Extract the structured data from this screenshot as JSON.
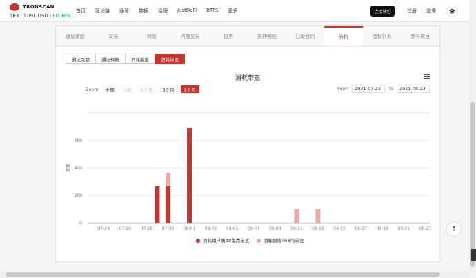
{
  "header": {
    "logo_text": "TRONSCAN",
    "price_label": "TRX: 0.091 USD",
    "price_change": "(+0.98%)",
    "nav": [
      "首页",
      "区块链",
      "通证",
      "数据",
      "治理",
      "JustDeFi",
      "BTFS",
      "更多"
    ],
    "connect_label": "连接钱包",
    "register_label": "注册",
    "login_label": "登录"
  },
  "tabs": [
    "通证余额",
    "交易",
    "转账",
    "内部交易",
    "投票",
    "质押明细",
    "已发合约",
    "分析",
    "授权列表",
    "参与项目"
  ],
  "active_tab": 7,
  "subtabs": [
    "通证余额",
    "通证转账",
    "消耗能量",
    "消耗带宽"
  ],
  "active_subtab": 3,
  "chart_controls": {
    "zoom_label": "Zoom",
    "zoom_options": [
      "全部",
      "1年",
      "6个月",
      "3个月",
      "1个月"
    ],
    "zoom_active": 4,
    "zoom_disabled": [
      1,
      2
    ],
    "from_label": "From",
    "from_value": "2021-07-23",
    "to_label": "To",
    "to_value": "2021-08-23"
  },
  "chart_data": {
    "type": "bar",
    "title": "消耗带宽",
    "ylabel": "带宽",
    "xlabel": "",
    "ylim": [
      0,
      800
    ],
    "yticks": [
      0,
      200,
      400,
      600
    ],
    "stacked": true,
    "grid": true,
    "legend_position": "bottom",
    "x_tick_labels": [
      "07-24",
      "07-26",
      "07-28",
      "07-30",
      "08-01",
      "08-03",
      "08-05",
      "08-07",
      "08-09",
      "08-11",
      "08-13",
      "08-15",
      "08-17",
      "08-19",
      "08-21",
      "08-23"
    ],
    "categories": [
      "07-23",
      "07-24",
      "07-25",
      "07-26",
      "07-27",
      "07-28",
      "07-29",
      "07-30",
      "07-31",
      "08-01",
      "08-02",
      "08-03",
      "08-04",
      "08-05",
      "08-06",
      "08-07",
      "08-08",
      "08-09",
      "08-10",
      "08-11",
      "08-12",
      "08-13",
      "08-14",
      "08-15",
      "08-16",
      "08-17",
      "08-18",
      "08-19",
      "08-20",
      "08-21",
      "08-22",
      "08-23"
    ],
    "series": [
      {
        "name": "消耗用户质押/免费带宽",
        "color": "#c23631",
        "values": [
          0,
          0,
          0,
          0,
          0,
          0,
          265,
          265,
          0,
          690,
          0,
          0,
          0,
          0,
          0,
          0,
          0,
          0,
          0,
          0,
          0,
          0,
          0,
          0,
          0,
          0,
          0,
          0,
          0,
          0,
          0,
          0
        ]
      },
      {
        "name": "消耗燃烧TRX的带宽",
        "color": "#e8a9a7",
        "values": [
          0,
          0,
          0,
          0,
          0,
          0,
          0,
          100,
          0,
          0,
          0,
          0,
          0,
          0,
          0,
          0,
          0,
          0,
          0,
          100,
          0,
          100,
          0,
          0,
          0,
          0,
          0,
          0,
          0,
          0,
          0,
          0
        ]
      }
    ]
  }
}
